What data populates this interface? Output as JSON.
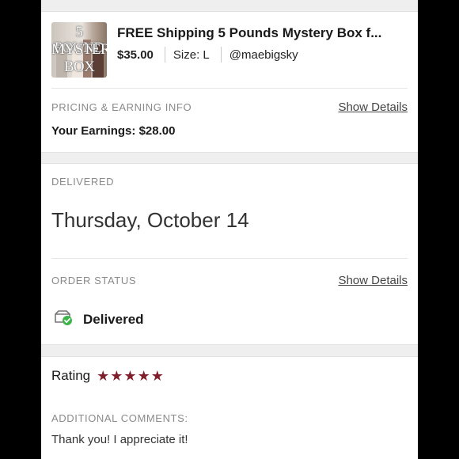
{
  "listing": {
    "thumb_text": [
      "5 POUND",
      "MYSTERY",
      "BOX"
    ],
    "title": "FREE Shipping 5 Pounds Mystery Box f...",
    "price": "$35.00",
    "size": "Size: L",
    "seller": "@maebigsky"
  },
  "pricing": {
    "label": "PRICING & EARNING INFO",
    "link": "Show Details",
    "earnings": "Your Earnings: $28.00"
  },
  "delivery": {
    "label": "DELIVERED",
    "date": "Thursday, October 14"
  },
  "order_status": {
    "label": "ORDER STATUS",
    "link": "Show Details",
    "status": "Delivered",
    "icon": "package-check-icon",
    "check_color": "#3db54a"
  },
  "rating": {
    "label": "Rating",
    "stars": 5,
    "star_color": "#7f1f2b"
  },
  "comments": {
    "label": "ADDITIONAL COMMENTS:",
    "text": "Thank you! I appreciate it!"
  }
}
